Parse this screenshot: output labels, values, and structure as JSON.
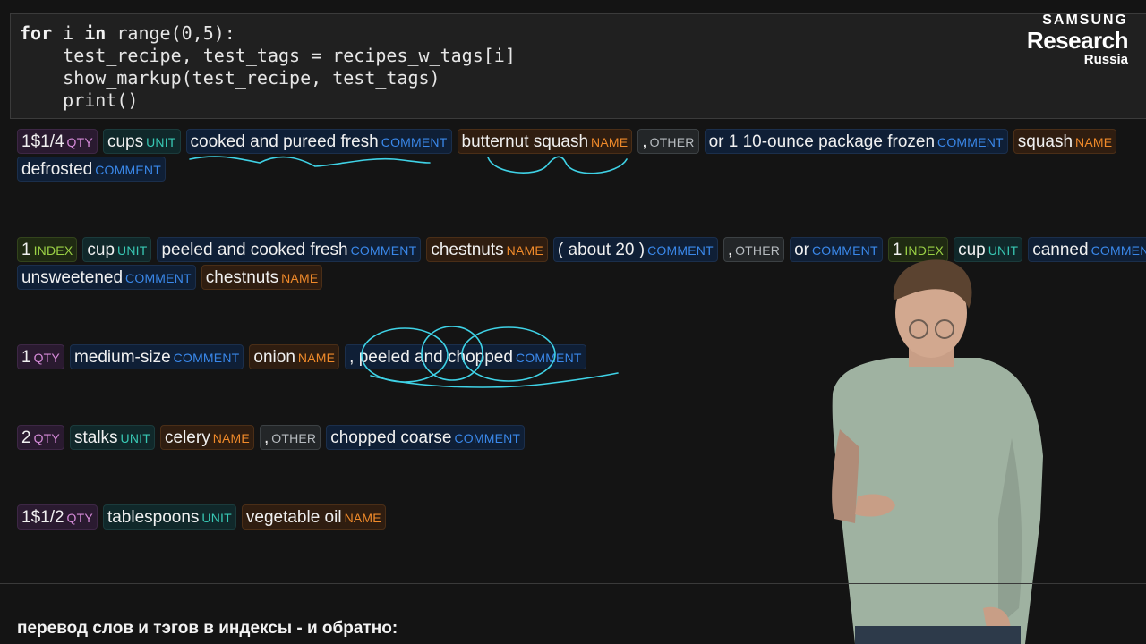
{
  "code": {
    "lines": [
      {
        "kw": "for",
        "t1": " i ",
        "kw2": "in",
        "t2": " range(0,5):"
      },
      {
        "text": "    test_recipe, test_tags = recipes_w_tags[i]"
      },
      {
        "text": "    show_markup(test_recipe, test_tags)"
      },
      {
        "text": "    print()"
      }
    ]
  },
  "brand": {
    "line1": "SAMSUNG",
    "line2": "Research",
    "line3": "Russia"
  },
  "recipes": [
    {
      "line_a": [
        {
          "text": "1$1/4",
          "tag": "QTY"
        },
        {
          "text": "cups",
          "tag": "UNIT"
        },
        {
          "text": "cooked and pureed fresh",
          "tag": "COMMENT"
        },
        {
          "text": "butternut squash",
          "tag": "NAME"
        },
        {
          "text": ",",
          "tag": "OTHER"
        },
        {
          "text": "or 1 10-ounce package frozen",
          "tag": "COMMENT"
        },
        {
          "text": "squash",
          "tag": "NAME"
        }
      ],
      "line_b": [
        {
          "text": "defrosted",
          "tag": "COMMENT"
        }
      ]
    },
    {
      "line_a": [
        {
          "text": "1",
          "tag": "INDEX"
        },
        {
          "text": "cup",
          "tag": "UNIT"
        },
        {
          "text": "peeled and cooked fresh",
          "tag": "COMMENT"
        },
        {
          "text": "chestnuts",
          "tag": "NAME"
        },
        {
          "text": "( about 20 )",
          "tag": "COMMENT"
        },
        {
          "text": ",",
          "tag": "OTHER"
        },
        {
          "text": "or",
          "tag": "COMMENT"
        },
        {
          "text": "1",
          "tag": "INDEX"
        },
        {
          "text": "cup",
          "tag": "UNIT"
        },
        {
          "text": "canned",
          "tag": "COMMENT"
        }
      ],
      "line_b": [
        {
          "text": "unsweetened",
          "tag": "COMMENT"
        },
        {
          "text": "chestnuts",
          "tag": "NAME"
        }
      ]
    },
    {
      "line_a": [
        {
          "text": "1",
          "tag": "QTY"
        },
        {
          "text": "medium-size",
          "tag": "COMMENT"
        },
        {
          "text": "onion",
          "tag": "NAME"
        },
        {
          "text": ", peeled and chopped",
          "tag": "COMMENT"
        }
      ]
    },
    {
      "line_a": [
        {
          "text": "2",
          "tag": "QTY"
        },
        {
          "text": "stalks",
          "tag": "UNIT"
        },
        {
          "text": "celery",
          "tag": "NAME"
        },
        {
          "text": ",",
          "tag": "OTHER"
        },
        {
          "text": "chopped coarse",
          "tag": "COMMENT"
        }
      ]
    },
    {
      "line_a": [
        {
          "text": "1$1/2",
          "tag": "QTY"
        },
        {
          "text": "tablespoons",
          "tag": "UNIT"
        },
        {
          "text": "vegetable oil",
          "tag": "NAME"
        }
      ]
    }
  ],
  "footer": {
    "text": "перевод слов и тэгов в индексы - и обратно:"
  }
}
